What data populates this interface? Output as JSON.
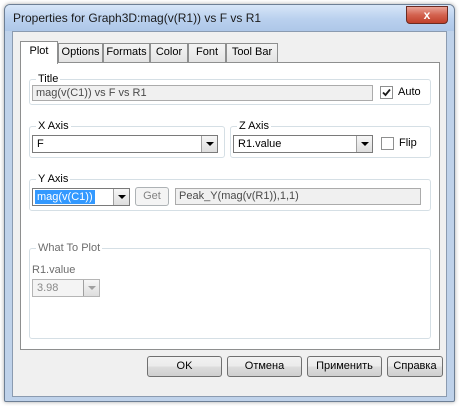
{
  "window": {
    "title": "Properties for Graph3D:mag(v(R1)) vs F vs R1",
    "close_glyph": "x"
  },
  "tabs": [
    {
      "label": "Plot"
    },
    {
      "label": "Options"
    },
    {
      "label": "Formats"
    },
    {
      "label": "Color"
    },
    {
      "label": "Font"
    },
    {
      "label": "Tool Bar"
    }
  ],
  "title_group": {
    "legend": "Title",
    "value": "mag(v(C1)) vs F vs R1",
    "auto_label": "Auto",
    "auto_checked": true
  },
  "x_axis": {
    "legend": "X Axis",
    "value": "F"
  },
  "z_axis": {
    "legend": "Z Axis",
    "value": "R1.value",
    "flip_label": "Flip",
    "flip_checked": false
  },
  "y_axis": {
    "legend": "Y Axis",
    "value": "mag(v(C1))",
    "get_label": "Get",
    "expression": "Peak_Y(mag(v(R1)),1,1)"
  },
  "what_to_plot": {
    "legend": "What To Plot",
    "param_label": "R1.value",
    "param_value": "3.98"
  },
  "buttons": {
    "ok": "OK",
    "cancel": "Отмена",
    "apply": "Применить",
    "help": "Справка"
  }
}
